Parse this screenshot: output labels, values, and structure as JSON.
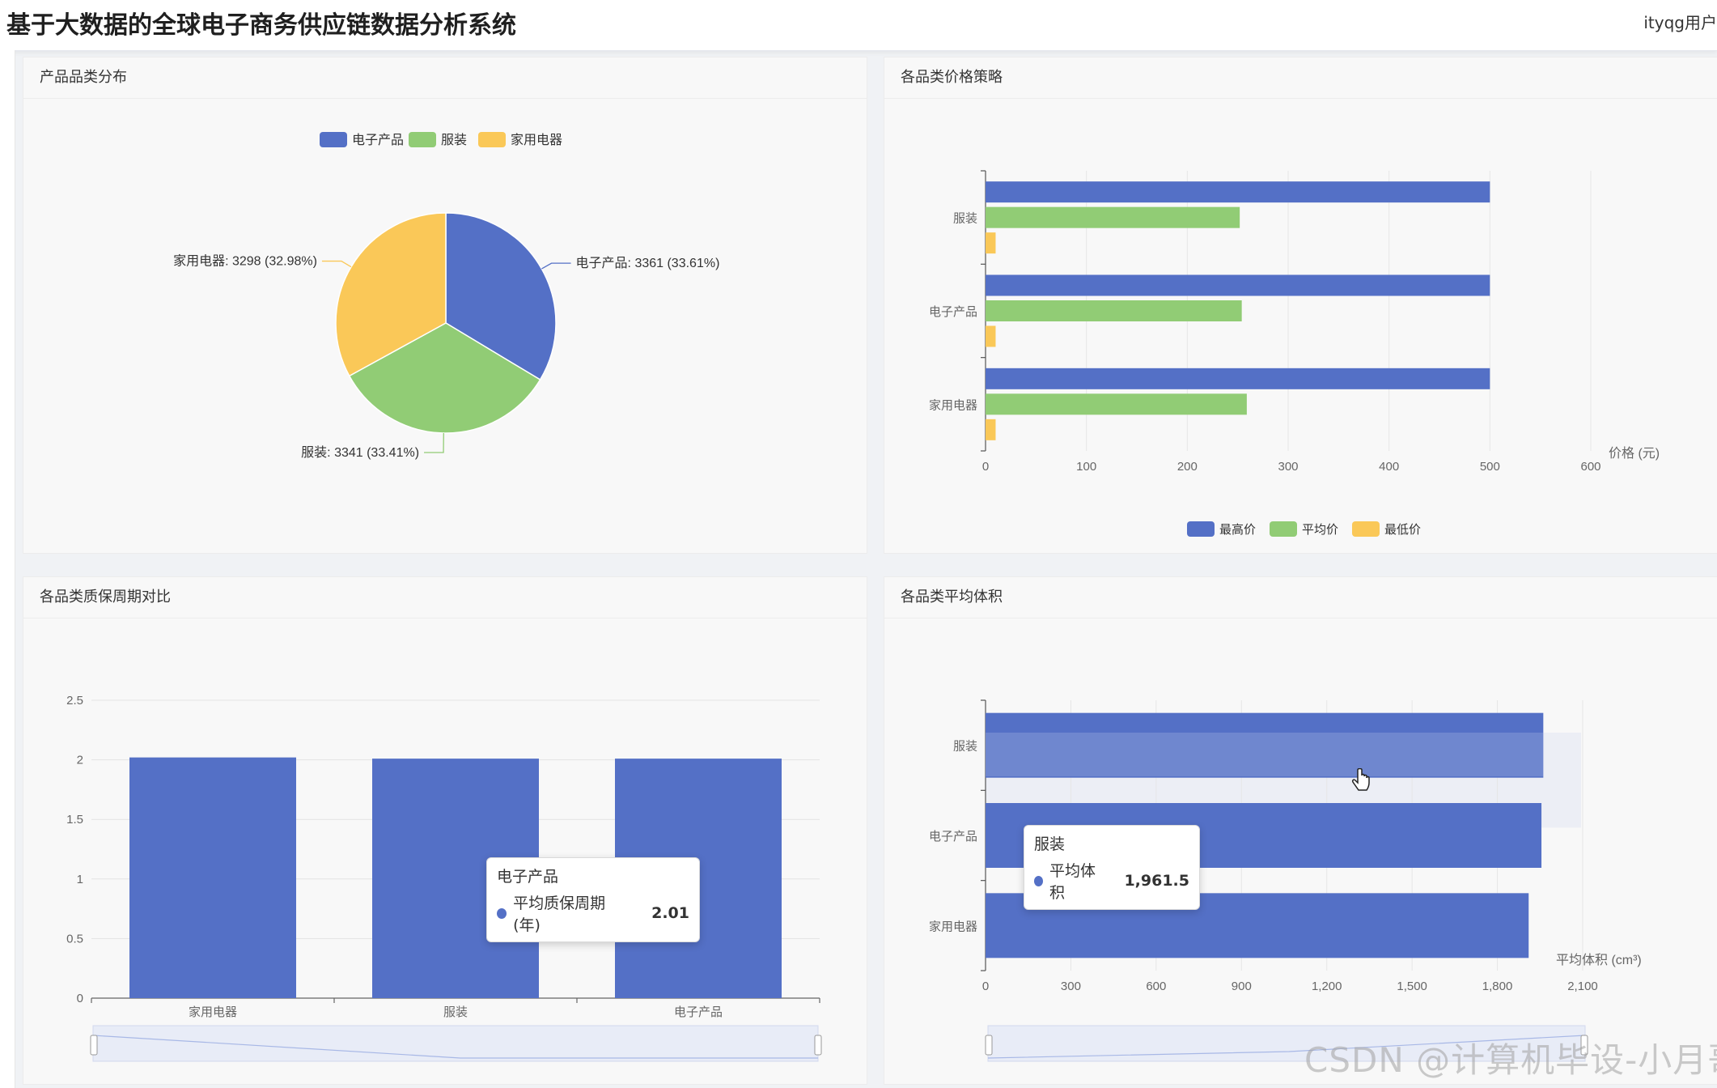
{
  "header": {
    "title": "基于大数据的全球电子商务供应链数据分析系统",
    "user": "ityqg用户"
  },
  "colors": {
    "blue": "#5470c6",
    "green": "#91cc75",
    "yellow": "#fac858"
  },
  "panels": {
    "pie": {
      "title": "产品品类分布"
    },
    "price": {
      "title": "各品类价格策略"
    },
    "warranty": {
      "title": "各品类质保周期对比"
    },
    "volume": {
      "title": "各品类平均体积"
    }
  },
  "chart_data": [
    {
      "type": "pie",
      "title": "产品品类分布",
      "legend": [
        "电子产品",
        "服装",
        "家用电器"
      ],
      "slices": [
        {
          "name": "电子产品",
          "value": 3361,
          "label": "电子产品: 3361 (33.61%)"
        },
        {
          "name": "服装",
          "value": 3341,
          "label": "服装: 3341 (33.41%)"
        },
        {
          "name": "家用电器",
          "value": 3298,
          "label": "家用电器: 3298 (32.98%)"
        }
      ]
    },
    {
      "type": "bar",
      "orientation": "horizontal",
      "title": "各品类价格策略",
      "categories": [
        "服装",
        "电子产品",
        "家用电器"
      ],
      "series": [
        {
          "name": "最高价",
          "values": [
            500,
            500,
            500
          ]
        },
        {
          "name": "平均价",
          "values": [
            252,
            254,
            259
          ]
        },
        {
          "name": "最低价",
          "values": [
            10,
            10,
            10
          ]
        }
      ],
      "xlabel": "价格 (元)",
      "xlim": [
        0,
        600
      ],
      "xticks": [
        "0",
        "100",
        "200",
        "300",
        "400",
        "500",
        "600"
      ],
      "legend_position": "bottom"
    },
    {
      "type": "bar",
      "title": "各品类质保周期对比",
      "categories": [
        "家用电器",
        "服装",
        "电子产品"
      ],
      "series": [
        {
          "name": "平均质保周期 (年)",
          "values": [
            2.02,
            2.01,
            2.01
          ]
        }
      ],
      "ylim": [
        0,
        2.5
      ],
      "yticks": [
        "0",
        "0.5",
        "1",
        "1.5",
        "2",
        "2.5"
      ],
      "tooltip": {
        "title": "电子产品",
        "series": "平均质保周期 (年)",
        "value": "2.01"
      }
    },
    {
      "type": "bar",
      "orientation": "horizontal",
      "title": "各品类平均体积",
      "categories": [
        "服装",
        "电子产品",
        "家用电器"
      ],
      "series": [
        {
          "name": "平均体积",
          "values": [
            1961.5,
            1955,
            1910
          ]
        }
      ],
      "xlabel": "平均体积 (cm³)",
      "xlim": [
        0,
        2100
      ],
      "xticks": [
        "0",
        "300",
        "600",
        "900",
        "1,200",
        "1,500",
        "1,800",
        "2,100"
      ],
      "tooltip": {
        "title": "服装",
        "series": "平均体积",
        "value": "1,961.5"
      }
    }
  ],
  "watermark": "CSDN @计算机毕设-小月哥"
}
